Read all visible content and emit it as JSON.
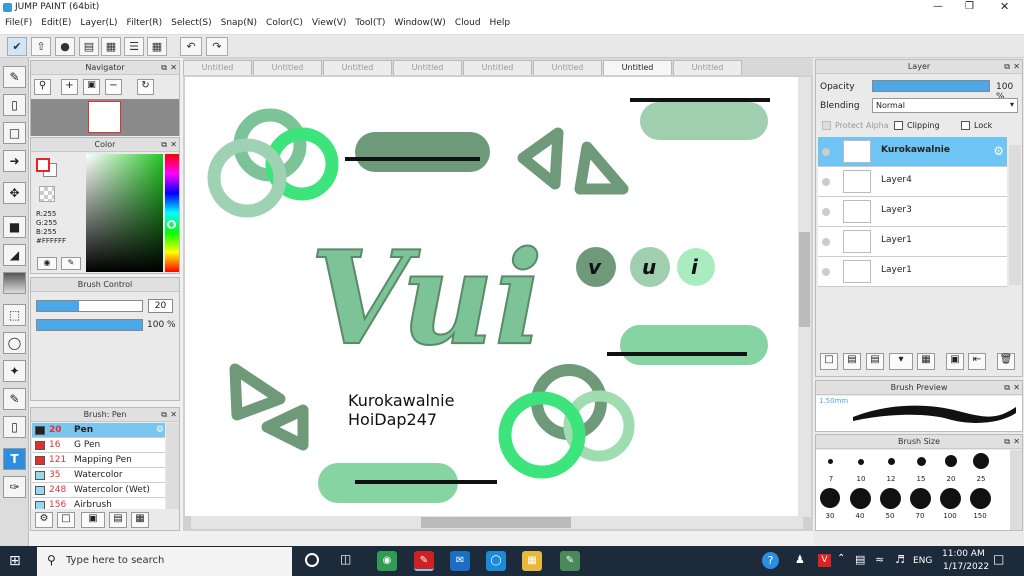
{
  "window": {
    "title": "JUMP PAINT (64bit)"
  },
  "menu": [
    "File(F)",
    "Edit(E)",
    "Layer(L)",
    "Filter(R)",
    "Select(S)",
    "Snap(N)",
    "Color(C)",
    "View(V)",
    "Tool(T)",
    "Window(W)",
    "Cloud",
    "Help"
  ],
  "panels": {
    "navigator": "Navigator",
    "color": "Color",
    "brush_control": "Brush Control",
    "brush_list": "Brush: Pen",
    "layer": "Layer",
    "brush_preview": "Brush Preview",
    "brush_size": "Brush Size"
  },
  "color": {
    "r": "R:255",
    "g": "G:255",
    "b": "B:255",
    "hex": "#FFFFFF"
  },
  "brush_control": {
    "size": "20",
    "opacity": "100 %",
    "size_level": 0.4,
    "opacity_level": 1.0
  },
  "brushes": [
    {
      "size": "20",
      "name": "Pen",
      "swatch": "#222222",
      "selected": true
    },
    {
      "size": "16",
      "name": "G Pen",
      "swatch": "#e03030"
    },
    {
      "size": "121",
      "name": "Mapping Pen",
      "swatch": "#e03030"
    },
    {
      "size": "35",
      "name": "Watercolor",
      "swatch": "#9ad8ee"
    },
    {
      "size": "248",
      "name": "Watercolor (Wet)",
      "swatch": "#9ad8ee"
    },
    {
      "size": "156",
      "name": "Airbrush",
      "swatch": "#9ad8ee"
    }
  ],
  "tabs": [
    "Untitled",
    "Untitled",
    "Untitled",
    "Untitled",
    "Untitled",
    "Untitled",
    "Untitled",
    "Untitled"
  ],
  "active_tab": 6,
  "canvas_text": {
    "title": "Vui",
    "bubbles": [
      "v",
      "u",
      "i"
    ],
    "line1": "Kurokawalnie",
    "line2": "HoiDap247"
  },
  "layer_panel": {
    "opacity_label": "Opacity",
    "opacity_value": "100 %",
    "blending_label": "Blending",
    "blending_value": "Normal",
    "protect_alpha": "Protect Alpha",
    "clipping": "Clipping",
    "lock": "Lock"
  },
  "layers": [
    {
      "name": "Kurokawalnie",
      "selected": true
    },
    {
      "name": "Layer4"
    },
    {
      "name": "Layer3"
    },
    {
      "name": "Layer1"
    },
    {
      "name": "Layer1"
    }
  ],
  "brush_preview_label": "1.50mm",
  "brush_sizes": [
    [
      "7",
      "10",
      "12",
      "15",
      "20",
      "25"
    ],
    [
      "30",
      "40",
      "50",
      "70",
      "100",
      "150"
    ]
  ],
  "taskbar": {
    "search": "Type here to search",
    "time": "11:00 AM",
    "date": "1/17/2022",
    "lang": "ENG"
  },
  "colors": {
    "accent": "#6ab4e8",
    "green_light": "#86d4a2",
    "green_dark": "#6e9a7a",
    "green_bright": "#3de47c"
  }
}
